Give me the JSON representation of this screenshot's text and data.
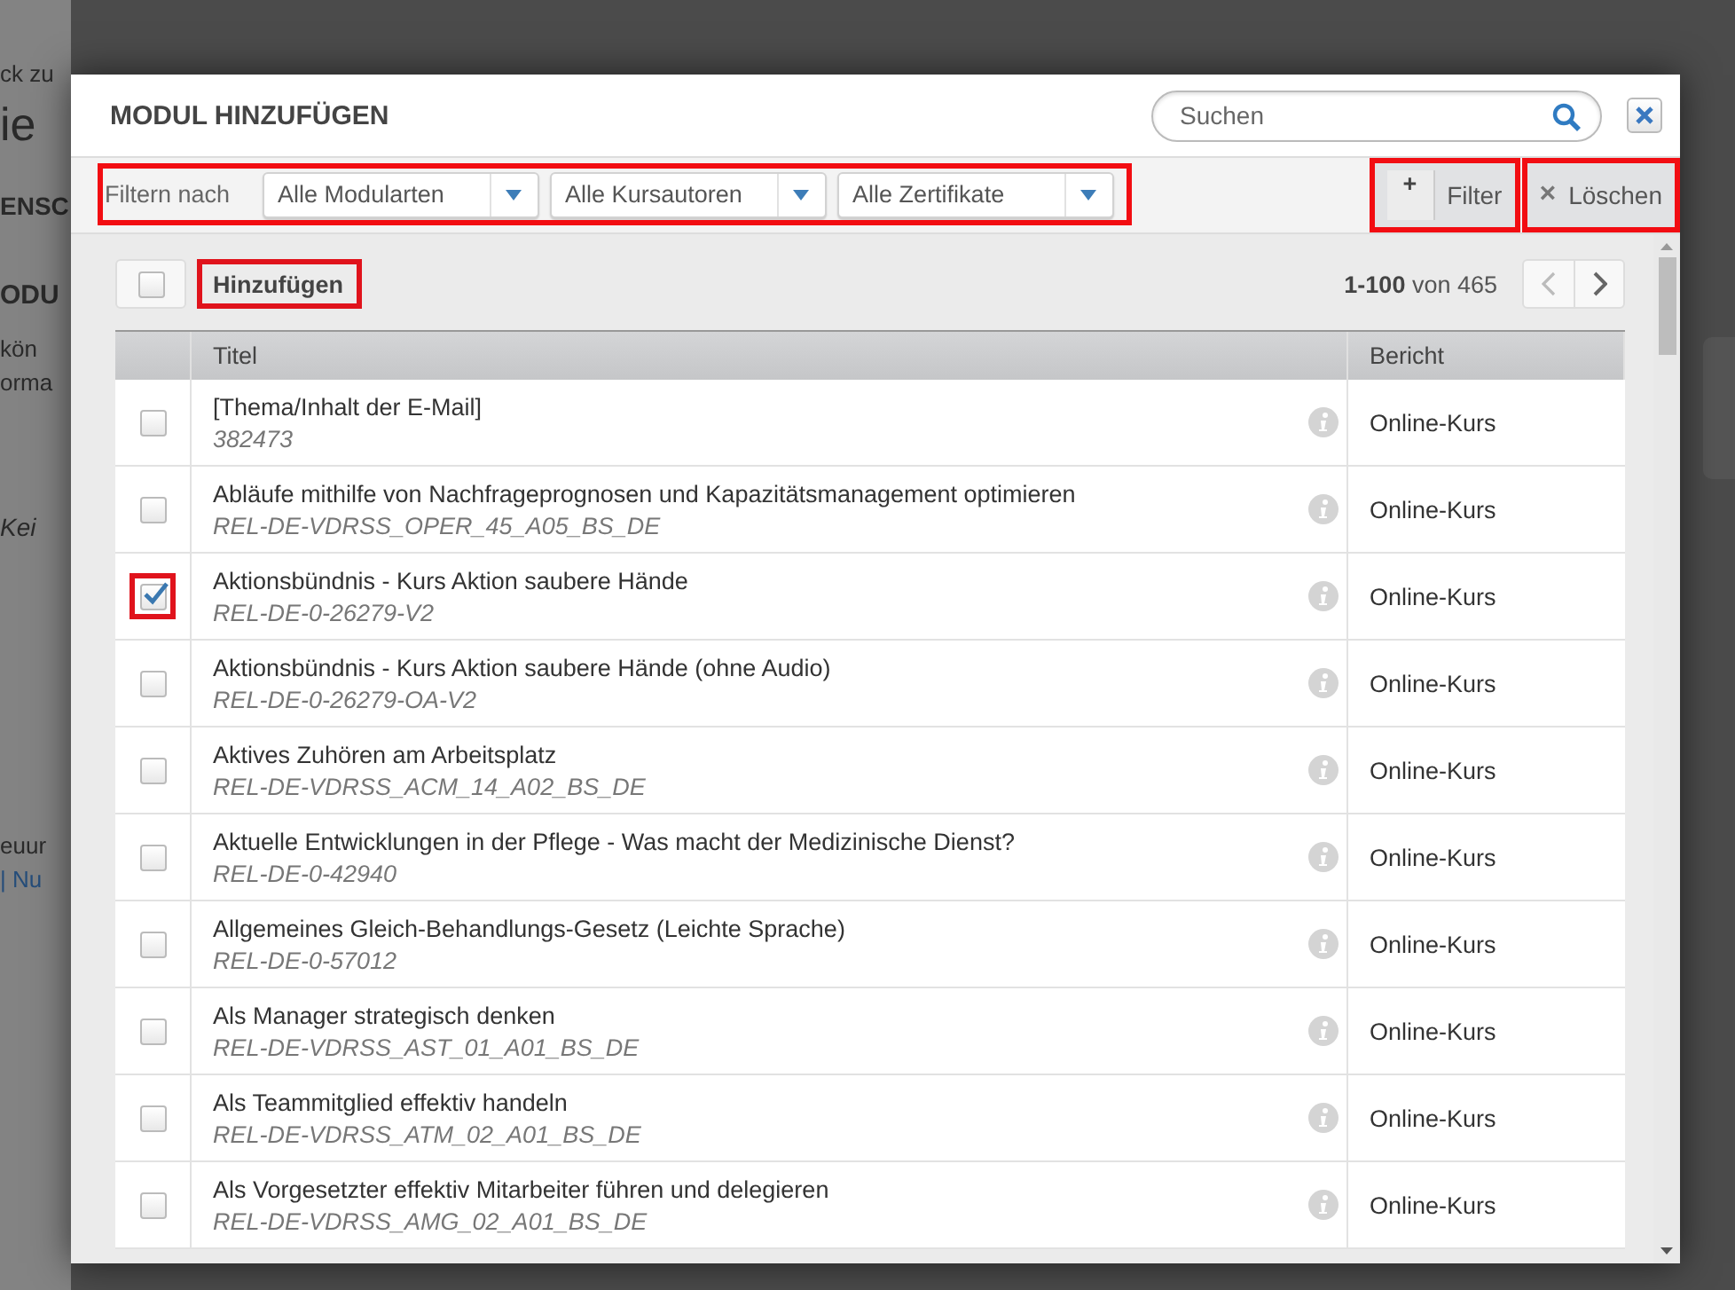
{
  "background_page": {
    "fragments": [
      "ck zu",
      "ie",
      "ENSC",
      "ODU",
      "kön",
      "orma",
      "Kei",
      "euur",
      "| Nu"
    ]
  },
  "dialog": {
    "title": "MODUL HINZUFÜGEN",
    "search": {
      "placeholder": "Suchen"
    },
    "filter_bar": {
      "label": "Filtern nach",
      "highlight": true,
      "dropdowns": [
        {
          "value": "Alle Modularten"
        },
        {
          "value": "Alle Kursautoren"
        },
        {
          "value": "Alle Zertifikate"
        }
      ]
    },
    "actions": [
      {
        "kind": "add",
        "icon": "+",
        "label": "Filter",
        "highlight": true
      },
      {
        "kind": "clear",
        "icon": "×",
        "label": "Löschen",
        "highlight": true
      }
    ],
    "toolbar": {
      "select_all": {
        "checked": false
      },
      "add_button": {
        "label": "Hinzufügen",
        "highlight": true
      },
      "range": "1-100",
      "range_suffix": "von 465"
    },
    "table": {
      "columns": [
        "Titel",
        "Bericht"
      ],
      "rows": [
        {
          "title": "[Thema/Inhalt der E-Mail]",
          "code": "382473",
          "report": "Online-Kurs",
          "checked": false,
          "highlight": false
        },
        {
          "title": "Abläufe mithilfe von Nachfrageprognosen und Kapazitätsmanagement optimieren",
          "code": "REL-DE-VDRSS_OPER_45_A05_BS_DE",
          "report": "Online-Kurs",
          "checked": false,
          "highlight": false
        },
        {
          "title": "Aktionsbündnis - Kurs Aktion saubere Hände",
          "code": "REL-DE-0-26279-V2",
          "report": "Online-Kurs",
          "checked": true,
          "highlight": true
        },
        {
          "title": "Aktionsbündnis - Kurs Aktion saubere Hände (ohne Audio)",
          "code": "REL-DE-0-26279-OA-V2",
          "report": "Online-Kurs",
          "checked": false,
          "highlight": false
        },
        {
          "title": "Aktives Zuhören am Arbeitsplatz",
          "code": "REL-DE-VDRSS_ACM_14_A02_BS_DE",
          "report": "Online-Kurs",
          "checked": false,
          "highlight": false
        },
        {
          "title": "Aktuelle Entwicklungen in der Pflege - Was macht der Medizinische Dienst?",
          "code": "REL-DE-0-42940",
          "report": "Online-Kurs",
          "checked": false,
          "highlight": false
        },
        {
          "title": "Allgemeines Gleich-Behandlungs-Gesetz (Leichte Sprache)",
          "code": "REL-DE-0-57012",
          "report": "Online-Kurs",
          "checked": false,
          "highlight": false
        },
        {
          "title": "Als Manager strategisch denken",
          "code": "REL-DE-VDRSS_AST_01_A01_BS_DE",
          "report": "Online-Kurs",
          "checked": false,
          "highlight": false
        },
        {
          "title": "Als Teammitglied effektiv handeln",
          "code": "REL-DE-VDRSS_ATM_02_A01_BS_DE",
          "report": "Online-Kurs",
          "checked": false,
          "highlight": false
        },
        {
          "title": "Als Vorgesetzter effektiv Mitarbeiter führen und delegieren",
          "code": "REL-DE-VDRSS_AMG_02_A01_BS_DE",
          "report": "Online-Kurs",
          "checked": false,
          "highlight": false
        }
      ]
    }
  }
}
